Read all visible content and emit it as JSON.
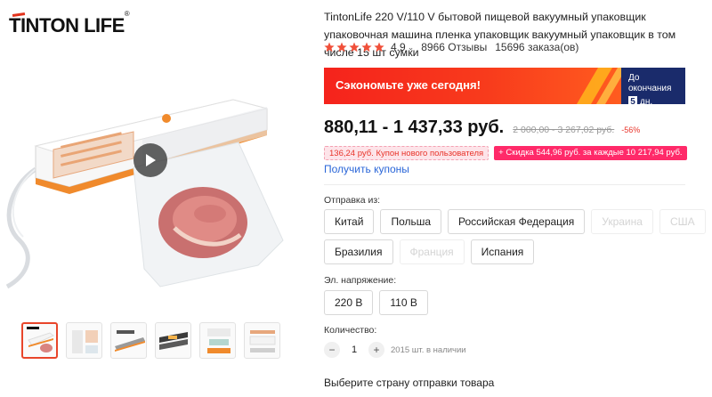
{
  "brand": {
    "logo_text": "TINTON LIFE",
    "trademark": "®"
  },
  "media": {
    "play_icon": "play-icon",
    "thumbnail_count": 6
  },
  "product": {
    "title": "TintonLife 220 V/110 V бытовой пищевой вакуумный упаковщик упаковочная машина пленка упаковщик вакуумный упаковщик в том числе 15 шт сумки",
    "rating": "4.9",
    "reviews": "8966 Отзывы",
    "orders": "15696 заказа(ов)",
    "stars": 5
  },
  "promo": {
    "text": "Сэкономьте уже сегодня!",
    "countdown_label": "До окончания",
    "countdown_days": "5",
    "countdown_unit": "дн."
  },
  "pricing": {
    "price": "880,11 - 1 437,33 руб.",
    "old_price": "2 000,00 - 3 267,02 руб.",
    "discount": "-56%"
  },
  "coupons": {
    "new_user": "136,24 руб. Купон нового пользователя",
    "discount": "+ Скидка 544,96 руб. за каждые 10 217,94 руб.",
    "get_link": "Получить купоны"
  },
  "shipping": {
    "label": "Отправка из:",
    "options": [
      {
        "label": "Китай",
        "disabled": false
      },
      {
        "label": "Польша",
        "disabled": false
      },
      {
        "label": "Российская Федерация",
        "disabled": false
      },
      {
        "label": "Украина",
        "disabled": true
      },
      {
        "label": "США",
        "disabled": true
      },
      {
        "label": "Бразилия",
        "disabled": false
      },
      {
        "label": "Франция",
        "disabled": true
      },
      {
        "label": "Испания",
        "disabled": false
      }
    ]
  },
  "voltage": {
    "label": "Эл. напряжение:",
    "options": [
      {
        "label": "220 В"
      },
      {
        "label": "110 В"
      }
    ]
  },
  "quantity": {
    "label": "Количество:",
    "value": "1",
    "minus": "−",
    "plus": "+",
    "stock": "2015 шт. в наличии"
  },
  "note": "Выберите страну отправки товара",
  "colors": {
    "accent": "#e8342a",
    "link": "#2a66d8",
    "countdown_bg": "#1a2b6b",
    "star": "#f0503a"
  }
}
